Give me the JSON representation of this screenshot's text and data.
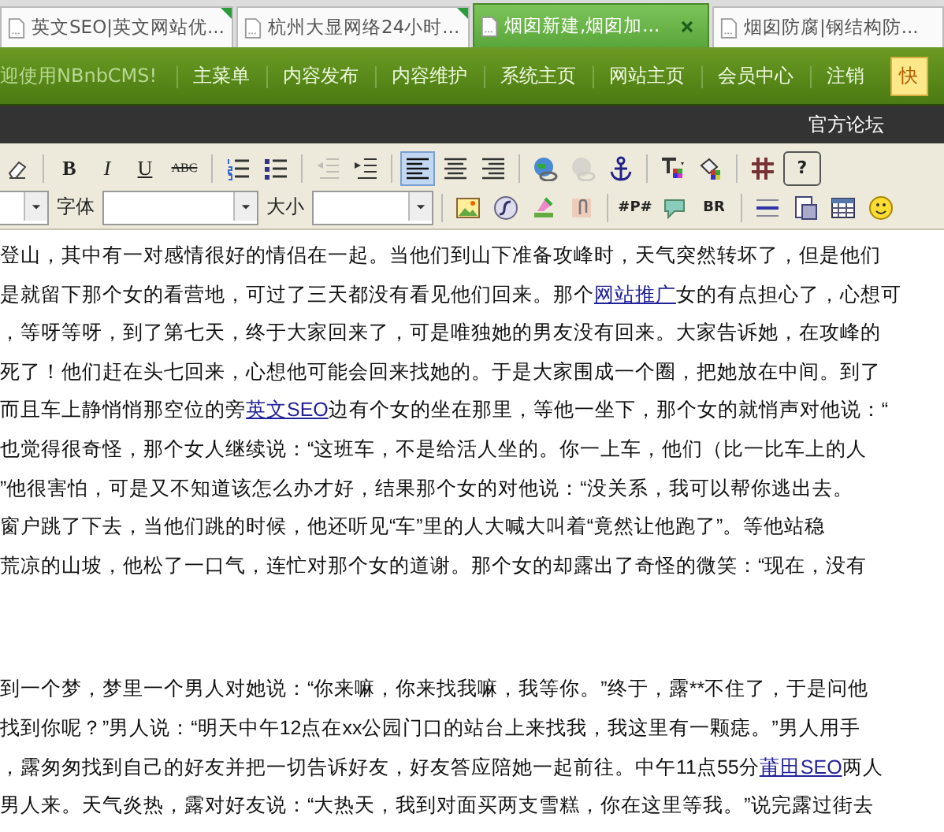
{
  "tabs": [
    {
      "title": "英文SEO|英文网站优...",
      "selected": false,
      "flagged": true
    },
    {
      "title": "杭州大显网络24小时...",
      "selected": false,
      "flagged": true
    },
    {
      "title": "烟囱新建,烟囱加...",
      "selected": true,
      "flagged": false
    },
    {
      "title": "烟囱防腐|钢结构防...",
      "selected": false,
      "flagged": false
    }
  ],
  "nav": {
    "welcome": "迎使用NBnbCMS!",
    "items": [
      "主菜单",
      "内容发布",
      "内容维护",
      "系统主页",
      "网站主页",
      "会员中心",
      "注销"
    ],
    "quick_button": "快"
  },
  "subbar": {
    "link": "官方论坛"
  },
  "toolbar": {
    "row_1": [
      {
        "kind": "button",
        "selected": false,
        "disabled": false
      },
      {
        "kind": "separator"
      },
      {
        "kind": "button",
        "label": "B",
        "selected": false,
        "disabled": false
      },
      {
        "kind": "button",
        "label": "I",
        "selected": false,
        "disabled": false
      },
      {
        "kind": "button",
        "label": "U",
        "selected": false,
        "disabled": false
      },
      {
        "kind": "button",
        "label": "ABC",
        "selected": false,
        "disabled": false
      },
      {
        "kind": "separator"
      },
      {
        "kind": "button",
        "selected": false,
        "disabled": false
      },
      {
        "kind": "button",
        "selected": false,
        "disabled": false
      },
      {
        "kind": "separator"
      },
      {
        "kind": "button",
        "selected": false,
        "disabled": true
      },
      {
        "kind": "button",
        "selected": false,
        "disabled": false
      },
      {
        "kind": "separator"
      },
      {
        "kind": "button",
        "selected": true,
        "disabled": false
      },
      {
        "kind": "button",
        "selected": false,
        "disabled": false
      },
      {
        "kind": "button",
        "selected": false,
        "disabled": false
      },
      {
        "kind": "separator"
      },
      {
        "kind": "button",
        "selected": false,
        "disabled": false
      },
      {
        "kind": "button",
        "selected": false,
        "disabled": true
      },
      {
        "kind": "button",
        "selected": false,
        "disabled": false
      },
      {
        "kind": "separator"
      },
      {
        "kind": "button",
        "selected": false,
        "disabled": false
      },
      {
        "kind": "button",
        "selected": false,
        "disabled": false
      },
      {
        "kind": "separator"
      },
      {
        "kind": "button",
        "selected": false,
        "disabled": false
      },
      {
        "kind": "button",
        "label": "?",
        "selected": false,
        "disabled": false
      }
    ],
    "row_2": [
      {
        "kind": "select"
      },
      {
        "kind": "label",
        "text": "字体"
      },
      {
        "kind": "select"
      },
      {
        "kind": "label",
        "text": "大小"
      },
      {
        "kind": "select"
      },
      {
        "kind": "separator"
      },
      {
        "kind": "button",
        "selected": false,
        "disabled": false
      },
      {
        "kind": "button",
        "selected": false,
        "disabled": false
      },
      {
        "kind": "button",
        "selected": false,
        "disabled": false
      },
      {
        "kind": "button",
        "selected": false,
        "disabled": false
      },
      {
        "kind": "separator"
      },
      {
        "kind": "button",
        "label": "#P#",
        "selected": false,
        "disabled": false
      },
      {
        "kind": "button",
        "selected": false,
        "disabled": false
      },
      {
        "kind": "button",
        "label": "BR",
        "selected": false,
        "disabled": false
      },
      {
        "kind": "separator"
      },
      {
        "kind": "button",
        "selected": false,
        "disabled": false
      },
      {
        "kind": "button",
        "selected": false,
        "disabled": false
      },
      {
        "kind": "button",
        "selected": false,
        "disabled": false
      },
      {
        "kind": "button",
        "selected": false,
        "disabled": false
      }
    ]
  },
  "content": {
    "paragraphs": [
      [
        [
          {
            "text": "登山，其中有一对感情很好的情侣在一起。当他们到山下准备攻峰时，天气突然转坏了，但是他们"
          }
        ],
        [
          {
            "text": "是就留下那个女的看营地，可过了三天都没有看见他们回来。那个"
          },
          {
            "text": "网站推广",
            "kind": "link"
          },
          {
            "text": "女的有点担心了，心想可"
          }
        ],
        [
          {
            "text": "，等呀等呀，到了第七天，终于大家回来了，可是唯独她的男友没有回来。大家告诉她，在攻峰的"
          }
        ],
        [
          {
            "text": "死了！他们赶在头七回来，心想他可能会回来找她的。于是大家围成一个圈，把她放在中间。到了"
          }
        ],
        [
          {
            "text": "而且车上静悄悄那空位的旁"
          },
          {
            "text": "英文SEO",
            "kind": "link"
          },
          {
            "text": "边有个女的坐在那里，等他一坐下，那个女的就悄声对他说：“"
          }
        ],
        [
          {
            "text": "也觉得很奇怪，那个女人继续说：“这班车，不是给活人坐的。你一上车，他们（比一比车上的人"
          }
        ],
        [
          {
            "text": "”他很害怕，可是又不知道该怎么办才好，结果那个女的对他说：“没关系，我可以帮你逃出去。"
          }
        ],
        [
          {
            "text": "窗户跳了下去，当他们跳的时候，他还听见“车”里的人大喊大叫着“竟然让他跑了”。等他站稳"
          }
        ],
        [
          {
            "text": "荒凉的山坡，他松了一口气，连忙对那个女的道谢。那个女的却露出了奇怪的微笑：“现在，没有"
          }
        ]
      ],
      [
        [
          {
            "text": "到一个梦，梦里一个男人对她说：“你来嘛，你来找我嘛，我等你。”终于，露**不住了，于是问他"
          }
        ],
        [
          {
            "text": "找到你呢？”男人说：“明天中午12点在xx公园门口的站台上来找我，我这里有一颗痣。”男人用手"
          }
        ],
        [
          {
            "text": "，露匆匆找到自己的好友并把一切告诉好友，好友答应陪她一起前往。中午11点55分"
          },
          {
            "text": "莆田SEO",
            "kind": "link"
          },
          {
            "text": "两人"
          }
        ],
        [
          {
            "text": "男人来。天气炎热，露对好友说：“大热天，我到对面买两支雪糕，你在这里等我。”说完露过街去"
          }
        ]
      ]
    ]
  }
}
